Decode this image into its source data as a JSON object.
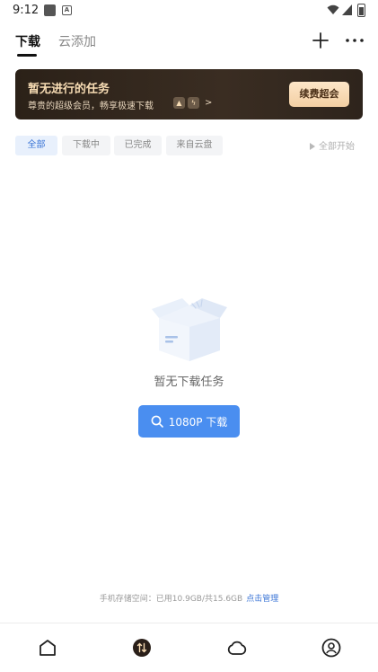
{
  "status_bar": {
    "time": "9:12",
    "app_badge": "A"
  },
  "header": {
    "tabs": [
      {
        "label": "下载",
        "active": true
      },
      {
        "label": "云添加",
        "active": false
      }
    ],
    "icons": [
      "plus-icon",
      "more-icon"
    ]
  },
  "banner": {
    "title": "暂无进行的任务",
    "subtitle": "尊贵的超级会员，畅享极速下载",
    "arrow": ">",
    "badges": [
      "rocket-icon",
      "bolt-icon"
    ],
    "button_label": "续费超会"
  },
  "filters": {
    "chips": [
      {
        "label": "全部",
        "selected": true
      },
      {
        "label": "下载中",
        "selected": false
      },
      {
        "label": "已完成",
        "selected": false
      },
      {
        "label": "来自云盘",
        "selected": false
      }
    ],
    "start_all_label": "全部开始"
  },
  "empty_state": {
    "message": "暂无下载任务",
    "button_label": "1080P 下载",
    "illustration": "empty-box"
  },
  "storage": {
    "text": "手机存储空间：已用10.9GB/共15.6GB",
    "link_label": "点击管理"
  },
  "bottom_nav": {
    "items": [
      "home-icon",
      "transfer-icon",
      "cloud-icon",
      "profile-icon"
    ]
  },
  "colors": {
    "accent": "#4a8ef0",
    "banner_bg": "#2b2118",
    "banner_text": "#f7dcb4",
    "link": "#3a74d6"
  }
}
